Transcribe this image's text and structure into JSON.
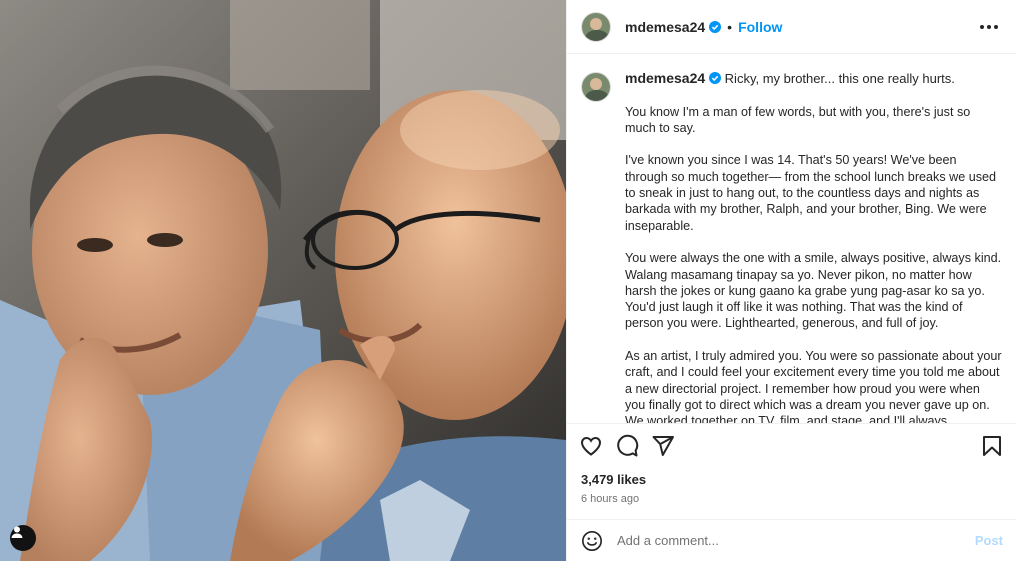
{
  "header": {
    "username": "mdemesa24",
    "dot": "•",
    "follow_label": "Follow"
  },
  "caption": {
    "username": "mdemesa24",
    "first_line": "Ricky, my brother... this one really hurts.",
    "paragraphs": [
      "You know I'm a man of few words, but with you, there's just so much to say.",
      "I've known you since I was 14. That's 50 years! We've been through so much together— from the school lunch breaks we used to sneak in just to hang out, to the countless days and nights as barkada with my brother, Ralph, and your brother, Bing. We were inseparable.",
      "You were always the one with a smile, always positive, always kind. Walang masamang tinapay sa yo. Never pikon, no matter how harsh the jokes or kung gaano ka grabe yung pag-asar ko sa yo. You'd just laugh it off like it was nothing. That was the kind of person you were. Lighthearted, generous, and full of joy.",
      "As an artist, I truly admired you. You were so passionate about your craft, and I could feel your excitement every time you told me about a new directorial project. I remember how proud you were when you finally got to direct which was a dream you never gave up on. We worked together on TV, film, and stage, and I'll always"
    ]
  },
  "stats": {
    "likes": "3,479 likes",
    "time": "6 hours ago"
  },
  "comment": {
    "placeholder": "Add a comment...",
    "post_label": "Post"
  },
  "icons": {
    "like": "heart-icon",
    "comment": "comment-icon",
    "share": "share-icon",
    "save": "bookmark-icon",
    "more": "more-options-icon",
    "emoji": "emoji-icon",
    "tag": "tagged-user-icon",
    "verified": "verified-badge-icon"
  },
  "colors": {
    "accent": "#0095f6",
    "post_disabled": "#b3dbff",
    "muted_text": "#737373",
    "divider": "#efefef"
  }
}
